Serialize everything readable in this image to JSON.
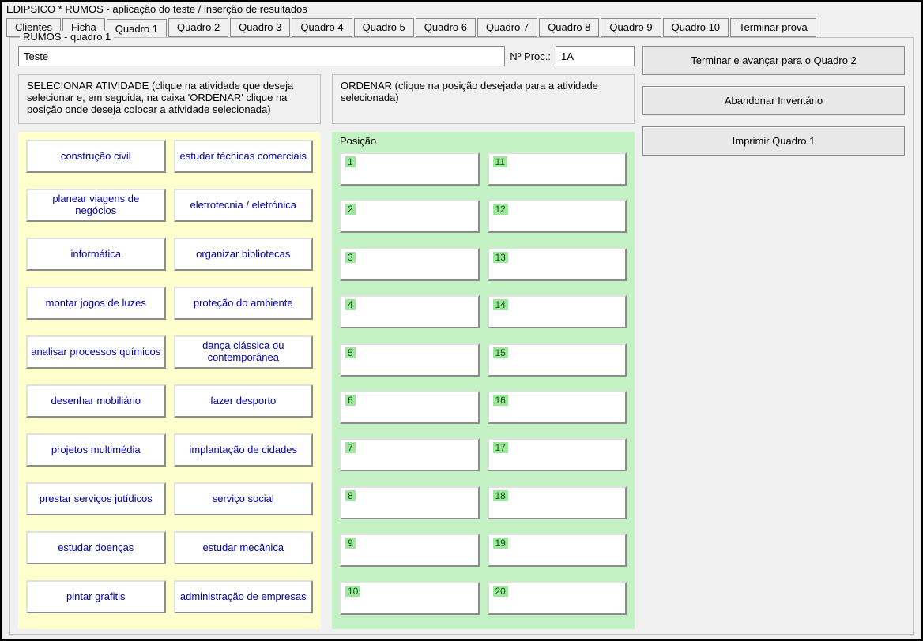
{
  "window_title": "EDIPSICO * RUMOS - aplicação  do teste / inserção de resultados",
  "tabs": [
    "Clientes",
    "Ficha",
    "Quadro 1",
    "Quadro 2",
    "Quadro 3",
    "Quadro 4",
    "Quadro 5",
    "Quadro 6",
    "Quadro 7",
    "Quadro 8",
    "Quadro 9",
    "Quadro 10",
    "Terminar prova"
  ],
  "active_tab_index": 2,
  "panel_title": "RUMOS - quadro 1",
  "teste_value": "Teste",
  "proc_label": "Nº Proc.:",
  "proc_value": "1A",
  "buttons": {
    "advance": "Terminar e avançar para o Quadro 2",
    "abandon": "Abandonar Inventário",
    "print": "Imprimir Quadro 1"
  },
  "select_legend": "SELECIONAR ATIVIDADE (clique na atividade que deseja selecionar e, em seguida, na caixa 'ORDENAR' clique na posição onde deseja colocar a atividade selecionada)",
  "order_legend": "ORDENAR (clique na posição desejada para a atividade selecionada)",
  "posicao_label": "Posição",
  "activities_col1": [
    "construção civil",
    "planear viagens de negócios",
    "informática",
    "montar jogos de luzes",
    "analisar processos químicos",
    "desenhar mobiliário",
    "projetos multimédia",
    "prestar serviços jutídicos",
    "estudar doenças",
    "pintar grafitis"
  ],
  "activities_col2": [
    "estudar técnicas comerciais",
    "eletrotecnia / eletrónica",
    "organizar bibliotecas",
    "proteção do ambiente",
    "dança clássica ou contemporânea",
    "fazer desporto",
    "implantação de cidades",
    "serviço social",
    "estudar mecânica",
    "administração de empresas"
  ],
  "positions_col1": [
    "1",
    "2",
    "3",
    "4",
    "5",
    "6",
    "7",
    "8",
    "9",
    "10"
  ],
  "positions_col2": [
    "11",
    "12",
    "13",
    "14",
    "15",
    "16",
    "17",
    "18",
    "19",
    "20"
  ]
}
